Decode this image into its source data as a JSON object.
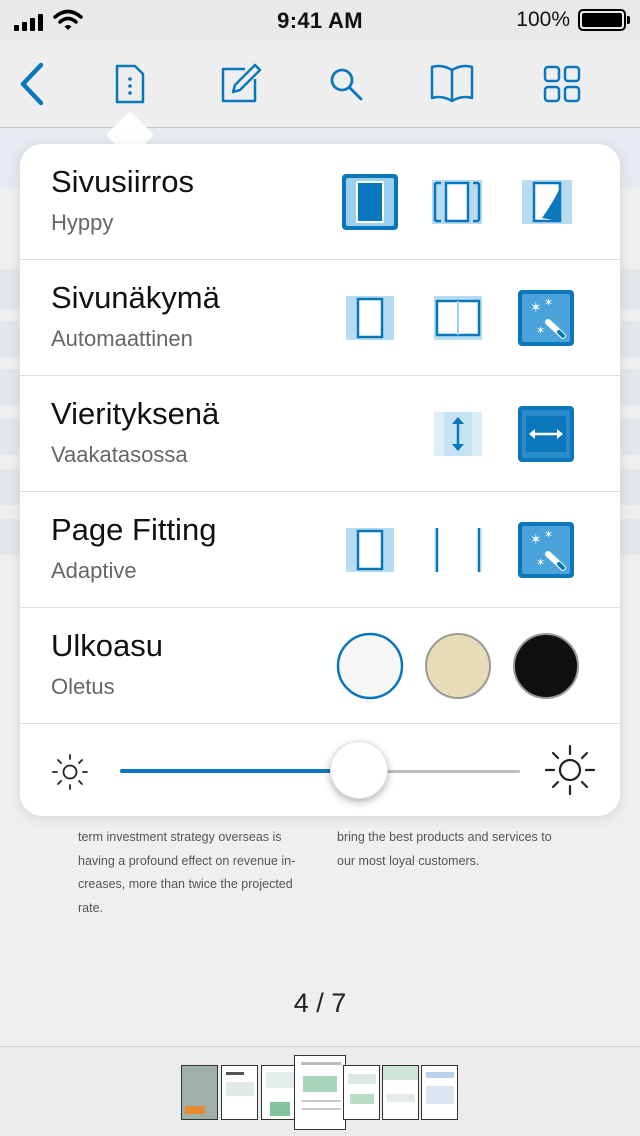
{
  "status_bar": {
    "time": "9:41 AM",
    "battery_text": "100%"
  },
  "toolbar": {
    "icons": [
      "back-chevron-icon",
      "document-icon",
      "edit-icon",
      "search-icon",
      "book-icon",
      "grid-icon"
    ]
  },
  "settings": {
    "rows": [
      {
        "title": "Sivusiirros",
        "value": "Hyppy",
        "options": [
          "jump-page-icon",
          "scroll-page-icon",
          "curl-page-icon"
        ],
        "selected": 0
      },
      {
        "title": "Sivunäkymä",
        "value": "Automaattinen",
        "options": [
          "single-page-icon",
          "two-page-icon",
          "auto-magic-wand-icon"
        ],
        "selected": 2
      },
      {
        "title": "Vierityksenä",
        "value": "Vaakatasossa",
        "options": [
          "vertical-scroll-icon",
          "horizontal-scroll-icon"
        ],
        "selected": 1
      },
      {
        "title": "Page Fitting",
        "value": "Adaptive",
        "options": [
          "fit-page-icon",
          "fit-width-icon",
          "adaptive-magic-wand-icon"
        ],
        "selected": 2
      },
      {
        "title": "Ulkoasu",
        "value": "Oletus",
        "options": [
          "white-theme",
          "sepia-theme",
          "night-theme"
        ],
        "selected": 0
      }
    ],
    "theme_colors": {
      "white": "#f7f7f7",
      "sepia": "#e8dbb8",
      "night": "#101010"
    },
    "brightness": {
      "level": 0.55,
      "min_icon": "sun-dim-icon",
      "max_icon": "sun-bright-icon"
    }
  },
  "document": {
    "left_column": [
      "term investment strategy overseas is",
      "having a profound effect on revenue in-",
      "creases, more than twice the projected",
      "rate."
    ],
    "right_column": [
      "bring the best products and services to",
      "our most loyal customers."
    ]
  },
  "pager": {
    "label": "4 / 7"
  },
  "colors": {
    "accent": "#0a77bd",
    "accent_light": "#a7d4ef"
  }
}
